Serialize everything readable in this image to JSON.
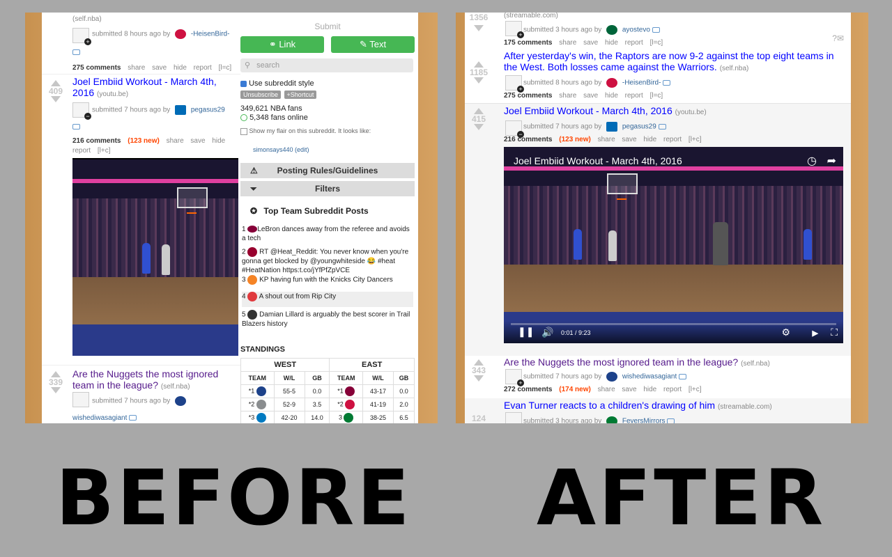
{
  "labels": {
    "before": "BEFORE",
    "after": "AFTER"
  },
  "colors": {
    "link": "#0000ff",
    "visited": "#551a8b",
    "new": "#ff4500",
    "green": "#46b754",
    "username": "#336699"
  },
  "before": {
    "top_post": {
      "domain": "(self.nba)",
      "submitted": "submitted 8 hours ago by",
      "user": "-HeisenBird-",
      "comments": "275 comments",
      "actions": [
        "share",
        "save",
        "hide",
        "report",
        "[l=c]"
      ]
    },
    "post1": {
      "score": "409",
      "title": "Joel Embiid Workout - March 4th, 2016",
      "domain": "(youtu.be)",
      "submitted": "submitted 7 hours ago by",
      "user": "pegasus29",
      "comments": "216 comments",
      "new": "(123 new)",
      "actions": [
        "share",
        "save",
        "hide"
      ],
      "actions2": [
        "report",
        "[l+c]"
      ]
    },
    "post2": {
      "score": "339",
      "title": "Are the Nuggets the most ignored team in the league?",
      "domain": "(self.nba)",
      "submitted": "submitted 7 hours ago by",
      "user": "wishediwasagiant"
    },
    "sidebar": {
      "submit_label": "Submit",
      "link_btn": "Link",
      "text_btn": "Text",
      "search_placeholder": "search",
      "use_style": "Use subreddit style",
      "unsubscribe": "Unsubscribe",
      "shortcut": "+Shortcut",
      "fans": "349,621 NBA fans",
      "online": "5,348 fans online",
      "flair_note": "Show my flair on this subreddit. It looks like:",
      "flair_user": "simonsays440",
      "edit": "(edit)",
      "rules": "Posting Rules/Guidelines",
      "filters": "Filters",
      "top_posts_title": "Top Team Subreddit Posts",
      "top_posts": [
        {
          "n": "1",
          "text": "LeBron dances away from the referee and avoids a tech"
        },
        {
          "n": "2",
          "text": "RT @Heat_Reddit: You never know when you're gonna get blocked by @youngwhiteside 😂 #heat #HeatNation https:t.co/jYfPfZpVCE"
        },
        {
          "n": "3",
          "text": "KP having fun with the Knicks City Dancers"
        },
        {
          "n": "4",
          "text": "A shout out from Rip City"
        },
        {
          "n": "5",
          "text": "Damian Lillard is arguably the best scorer in Trail Blazers history"
        }
      ],
      "standings_title": "STANDINGS",
      "west": "WEST",
      "east": "EAST",
      "headers": [
        "TEAM",
        "W/L",
        "GB",
        "TEAM",
        "W/L",
        "GB"
      ],
      "rows": [
        {
          "w_rank": "*1",
          "w_wl": "55-5",
          "w_gb": "0.0",
          "e_rank": "*1",
          "e_wl": "43-17",
          "e_gb": "0.0"
        },
        {
          "w_rank": "*2",
          "w_wl": "52-9",
          "w_gb": "3.5",
          "e_rank": "*2",
          "e_wl": "41-19",
          "e_gb": "2.0"
        },
        {
          "w_rank": "*3",
          "w_wl": "42-20",
          "w_gb": "14.0",
          "e_rank": "3",
          "e_wl": "38-25",
          "e_gb": "6.5"
        }
      ]
    }
  },
  "after": {
    "top_post": {
      "score": "1356",
      "domain": "(streamable.com)",
      "submitted": "submitted 3 hours ago by",
      "user": "ayostevo",
      "comments": "175 comments",
      "actions": [
        "share",
        "save",
        "hide",
        "report",
        "[l=c]"
      ]
    },
    "post1": {
      "score": "1185",
      "title": "After yesterday's win, the Raptors are now 9-2 against the top eight teams in the West. Both losses came against the Warriors.",
      "domain": "(self.nba)",
      "submitted": "submitted 8 hours ago by",
      "user": "-HeisenBird-",
      "comments": "275 comments",
      "actions": [
        "share",
        "save",
        "hide",
        "report",
        "[l=c]"
      ]
    },
    "post2": {
      "score": "415",
      "title": "Joel Embiid Workout - March 4th, 2016",
      "domain": "(youtu.be)",
      "submitted": "submitted 7 hours ago by",
      "user": "pegasus29",
      "comments": "216 comments",
      "new": "(123 new)",
      "actions": [
        "share",
        "save",
        "hide",
        "report",
        "[l+c]"
      ],
      "video_title": "Joel Embiid Workout - March 4th, 2016",
      "video_time": "0:01 / 9:23"
    },
    "post3": {
      "score": "343",
      "title": "Are the Nuggets the most ignored team in the league?",
      "domain": "(self.nba)",
      "submitted": "submitted 7 hours ago by",
      "user": "wishediwasagiant",
      "comments": "272 comments",
      "new": "(174 new)",
      "actions": [
        "share",
        "save",
        "hide",
        "report",
        "[l+c]"
      ]
    },
    "post4": {
      "score": "124",
      "title": "Evan Turner reacts to a children's drawing of him",
      "domain": "(streamable.com)",
      "submitted": "submitted 3 hours ago by",
      "user": "FeversMirrors"
    }
  }
}
